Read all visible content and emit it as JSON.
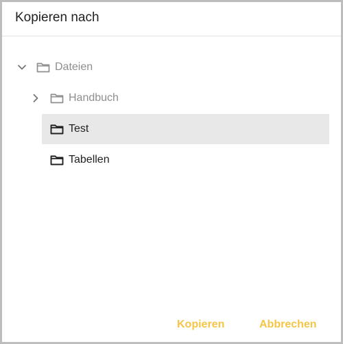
{
  "dialog": {
    "title": "Kopieren nach"
  },
  "tree": {
    "root": {
      "label": "Dateien",
      "expanded": true,
      "icon": "folder-outline-icon"
    },
    "children": [
      {
        "label": "Handbuch",
        "icon": "folder-outline-icon",
        "has_children": true,
        "selected": false,
        "disabled": true
      },
      {
        "label": "Test",
        "icon": "folder-outline-icon",
        "has_children": false,
        "selected": true,
        "disabled": false
      },
      {
        "label": "Tabellen",
        "icon": "folder-outline-icon",
        "has_children": false,
        "selected": false,
        "disabled": false
      }
    ]
  },
  "actions": {
    "copy_label": "Kopieren",
    "cancel_label": "Abbrechen"
  },
  "colors": {
    "accent": "#f7c546",
    "selected_row": "#e8e8e8",
    "muted_text": "#8e8e8e",
    "text": "#212121",
    "border": "#bdbdbd"
  }
}
